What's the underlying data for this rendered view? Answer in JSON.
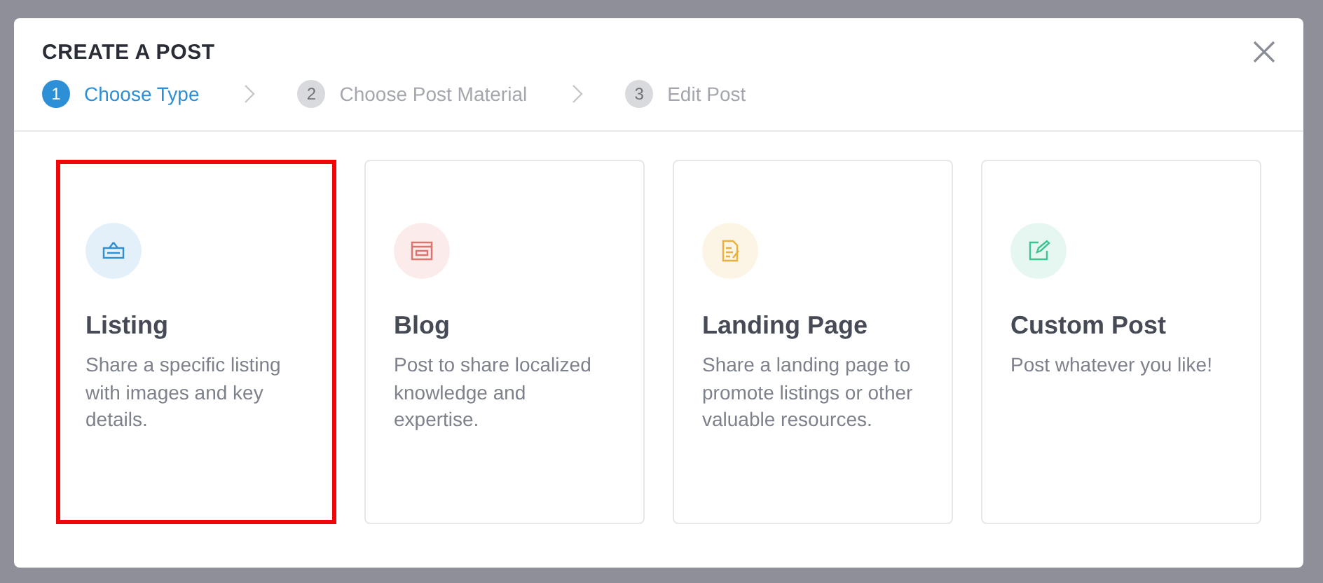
{
  "modal": {
    "title": "CREATE A POST",
    "steps": [
      {
        "number": "1",
        "label": "Choose Type",
        "selected": true
      },
      {
        "number": "2",
        "label": "Choose Post Material",
        "selected": false
      },
      {
        "number": "3",
        "label": "Edit Post",
        "selected": false
      }
    ],
    "cards": [
      {
        "kind": "listing",
        "title": "Listing",
        "description": "Share a specific listing with images and key details.",
        "selected": true,
        "color": "#2d8fd5"
      },
      {
        "kind": "blog",
        "title": "Blog",
        "description": "Post to share localized knowledge and expertise.",
        "selected": false,
        "color": "#e0716b"
      },
      {
        "kind": "landing",
        "title": "Landing Page",
        "description": "Share a landing page to promote listings or other valuable resources.",
        "selected": false,
        "color": "#e9b13c"
      },
      {
        "kind": "custom",
        "title": "Custom Post",
        "description": "Post whatever you like!",
        "selected": false,
        "color": "#3cc391"
      }
    ]
  }
}
